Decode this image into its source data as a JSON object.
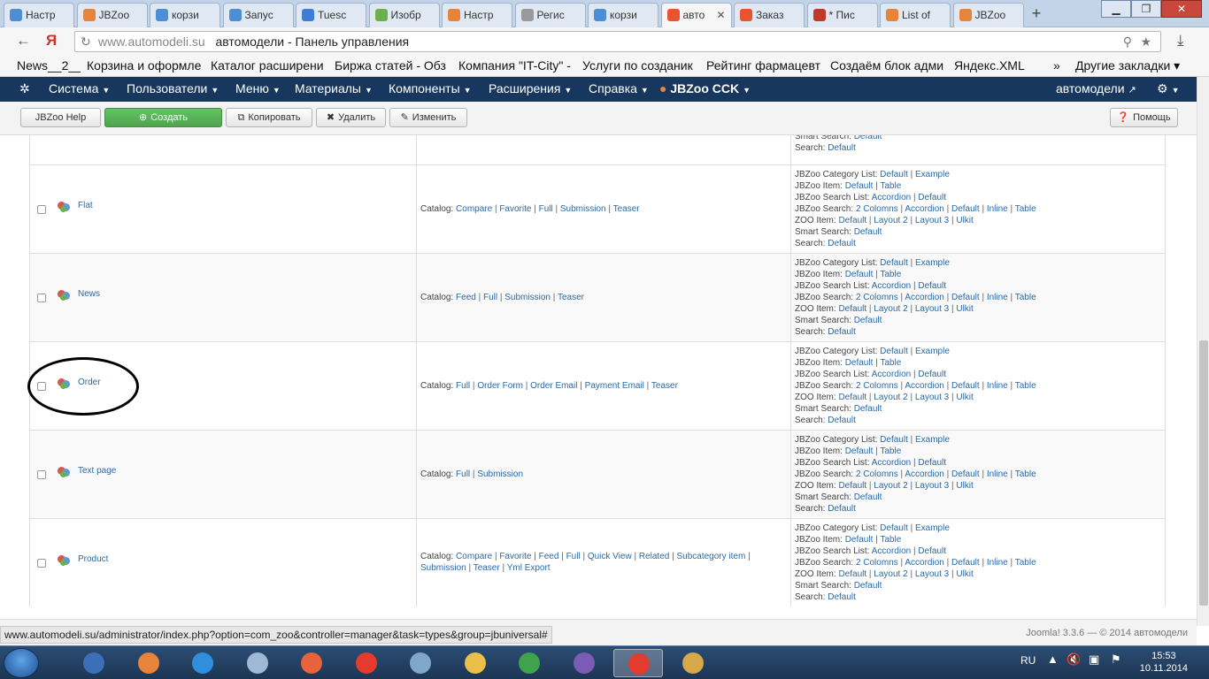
{
  "browser": {
    "tabs": [
      {
        "label": "Настр",
        "color": "#4c8fd6"
      },
      {
        "label": "JBZoo",
        "color": "#e8833a"
      },
      {
        "label": "корзи",
        "color": "#4c8fd6"
      },
      {
        "label": "Запус",
        "color": "#4c8fd6"
      },
      {
        "label": "Tuesc",
        "color": "#3b7dd8"
      },
      {
        "label": "Изобр",
        "color": "#6ab04c"
      },
      {
        "label": "Настр",
        "color": "#e8833a"
      },
      {
        "label": "Регис",
        "color": "#999999"
      },
      {
        "label": "корзи",
        "color": "#4c8fd6"
      },
      {
        "label": "авто",
        "color": "#e8542c"
      },
      {
        "label": "Заказ",
        "color": "#e8542c"
      },
      {
        "label": "* Пис",
        "color": "#c0392b"
      },
      {
        "label": "List of",
        "color": "#e8833a"
      },
      {
        "label": "JBZoo",
        "color": "#e8833a"
      }
    ],
    "active_tab_index": 9,
    "url": "www.automodeli.su",
    "page_title": "автомодели - Панель управления",
    "bookmarks": [
      "News__2__",
      "Корзина и оформле",
      "Каталог расширени",
      "Биржа статей - Обз",
      "Компания \"IT-City\" -",
      "Услуги по созданик",
      "Рейтинг фармацевт",
      "Создаём блок адми",
      "Яндекс.XML"
    ],
    "bookmarks_more": "»",
    "other_bookmarks": "Другие закладки ▾"
  },
  "joomla_nav": {
    "menus": [
      "Система",
      "Пользователи",
      "Меню",
      "Материалы",
      "Компоненты",
      "Расширения",
      "Справка",
      "JBZoo CCK"
    ],
    "site_link": "автомодели",
    "colors": {
      "navbar": "#17375e",
      "link": "#2a6aa8",
      "success": "#51a351"
    }
  },
  "toolbar": {
    "jbzoo_help": "JBZoo Help",
    "create": "Создать",
    "copy": "Копировать",
    "delete": "Удалить",
    "edit": "Изменить",
    "help": "Помощь"
  },
  "top_partial": {
    "lines": [
      {
        "label": "Smart Search:",
        "links": [
          "Default"
        ]
      },
      {
        "label": "Search:",
        "links": [
          "Default"
        ]
      }
    ]
  },
  "types": [
    {
      "name": "Flat",
      "templates_label": "Catalog:",
      "templates": [
        "Compare",
        "Favorite",
        "Full",
        "Submission",
        "Teaser"
      ],
      "assignments": [
        {
          "label": "JBZoo Category List:",
          "links": [
            "Default",
            "Example"
          ]
        },
        {
          "label": "JBZoo Item:",
          "links": [
            "Default",
            "Table"
          ]
        },
        {
          "label": "JBZoo Search List:",
          "links": [
            "Accordion",
            "Default"
          ]
        },
        {
          "label": "JBZoo Search:",
          "links": [
            "2 Colomns",
            "Accordion",
            "Default",
            "Inline",
            "Table"
          ]
        },
        {
          "label": "ZOO Item:",
          "links": [
            "Default",
            "Layout 2",
            "Layout 3",
            "Ulkit"
          ]
        },
        {
          "label": "Smart Search:",
          "links": [
            "Default"
          ]
        },
        {
          "label": "Search:",
          "links": [
            "Default"
          ]
        }
      ]
    },
    {
      "name": "News",
      "templates_label": "Catalog:",
      "templates": [
        "Feed",
        "Full",
        "Submission",
        "Teaser"
      ],
      "assignments": [
        {
          "label": "JBZoo Category List:",
          "links": [
            "Default",
            "Example"
          ]
        },
        {
          "label": "JBZoo Item:",
          "links": [
            "Default",
            "Table"
          ]
        },
        {
          "label": "JBZoo Search List:",
          "links": [
            "Accordion",
            "Default"
          ]
        },
        {
          "label": "JBZoo Search:",
          "links": [
            "2 Colomns",
            "Accordion",
            "Default",
            "Inline",
            "Table"
          ]
        },
        {
          "label": "ZOO Item:",
          "links": [
            "Default",
            "Layout 2",
            "Layout 3",
            "Ulkit"
          ]
        },
        {
          "label": "Smart Search:",
          "links": [
            "Default"
          ]
        },
        {
          "label": "Search:",
          "links": [
            "Default"
          ]
        }
      ]
    },
    {
      "name": "Order",
      "templates_label": "Catalog:",
      "templates": [
        "Full",
        "Order Form",
        "Order Email",
        "Payment Email",
        "Teaser"
      ],
      "assignments": [
        {
          "label": "JBZoo Category List:",
          "links": [
            "Default",
            "Example"
          ]
        },
        {
          "label": "JBZoo Item:",
          "links": [
            "Default",
            "Table"
          ]
        },
        {
          "label": "JBZoo Search List:",
          "links": [
            "Accordion",
            "Default"
          ]
        },
        {
          "label": "JBZoo Search:",
          "links": [
            "2 Colomns",
            "Accordion",
            "Default",
            "Inline",
            "Table"
          ]
        },
        {
          "label": "ZOO Item:",
          "links": [
            "Default",
            "Layout 2",
            "Layout 3",
            "Ulkit"
          ]
        },
        {
          "label": "Smart Search:",
          "links": [
            "Default"
          ]
        },
        {
          "label": "Search:",
          "links": [
            "Default"
          ]
        }
      ]
    },
    {
      "name": "Text page",
      "templates_label": "Catalog:",
      "templates": [
        "Full",
        "Submission"
      ],
      "assignments": [
        {
          "label": "JBZoo Category List:",
          "links": [
            "Default",
            "Example"
          ]
        },
        {
          "label": "JBZoo Item:",
          "links": [
            "Default",
            "Table"
          ]
        },
        {
          "label": "JBZoo Search List:",
          "links": [
            "Accordion",
            "Default"
          ]
        },
        {
          "label": "JBZoo Search:",
          "links": [
            "2 Colomns",
            "Accordion",
            "Default",
            "Inline",
            "Table"
          ]
        },
        {
          "label": "ZOO Item:",
          "links": [
            "Default",
            "Layout 2",
            "Layout 3",
            "Ulkit"
          ]
        },
        {
          "label": "Smart Search:",
          "links": [
            "Default"
          ]
        },
        {
          "label": "Search:",
          "links": [
            "Default"
          ]
        }
      ]
    },
    {
      "name": "Product",
      "templates_label": "Catalog:",
      "templates": [
        "Compare",
        "Favorite",
        "Feed",
        "Full",
        "Quick View",
        "Related",
        "Subcategory item",
        "Submission",
        "Teaser",
        "Yml Export"
      ],
      "assignments": [
        {
          "label": "JBZoo Category List:",
          "links": [
            "Default",
            "Example"
          ]
        },
        {
          "label": "JBZoo Item:",
          "links": [
            "Default",
            "Table"
          ]
        },
        {
          "label": "JBZoo Search List:",
          "links": [
            "Accordion",
            "Default"
          ]
        },
        {
          "label": "JBZoo Search:",
          "links": [
            "2 Colomns",
            "Accordion",
            "Default",
            "Inline",
            "Table"
          ]
        },
        {
          "label": "ZOO Item:",
          "links": [
            "Default",
            "Layout 2",
            "Layout 3",
            "Ulkit"
          ]
        },
        {
          "label": "Smart Search:",
          "links": [
            "Default"
          ]
        },
        {
          "label": "Search:",
          "links": [
            "Default"
          ]
        }
      ]
    }
  ],
  "status_url": "www.automodeli.su/administrator/index.php?option=com_zoo&controller=manager&task=types&group=jbuniversal#",
  "version": "Joomla! 3.3.6 — © 2014 автомодели",
  "taskbar": {
    "icons": [
      {
        "name": "thunderbird-icon",
        "color": "#3b6fb6"
      },
      {
        "name": "media-player-icon",
        "color": "#e8833a"
      },
      {
        "name": "internet-explorer-icon",
        "color": "#2f8fdc"
      },
      {
        "name": "sound-icon",
        "color": "#9fb8d6"
      },
      {
        "name": "firefox-icon",
        "color": "#e8633a"
      },
      {
        "name": "yandex-browser-icon",
        "color": "#e33b2e"
      },
      {
        "name": "calculator-icon",
        "color": "#7fa7cc"
      },
      {
        "name": "explorer-icon",
        "color": "#e8c04a"
      },
      {
        "name": "chrome-icon",
        "color": "#3fa34d"
      },
      {
        "name": "visual-studio-icon",
        "color": "#7a5bb5"
      },
      {
        "name": "yandex-browser-active-icon",
        "color": "#e33b2e"
      },
      {
        "name": "paint-icon",
        "color": "#d6a84a"
      }
    ],
    "active_index": 10,
    "lang": "RU",
    "time": "15:53",
    "date": "10.11.2014"
  }
}
